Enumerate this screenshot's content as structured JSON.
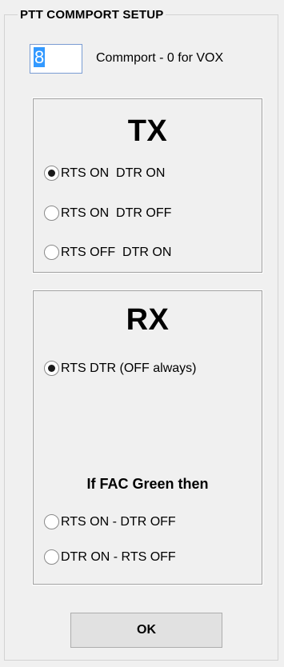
{
  "group": {
    "title": "PTT COMMPORT SETUP"
  },
  "commport": {
    "value": "8",
    "label": "Commport - 0 for VOX"
  },
  "tx": {
    "heading": "TX",
    "options": [
      {
        "label": "RTS ON  DTR ON",
        "checked": true
      },
      {
        "label": "RTS ON  DTR OFF",
        "checked": false
      },
      {
        "label": "RTS OFF  DTR ON",
        "checked": false
      }
    ]
  },
  "rx": {
    "heading": "RX",
    "always_option": {
      "label": "RTS DTR (OFF always)",
      "checked": true
    },
    "fac_heading": "If FAC Green then",
    "fac_options": [
      {
        "label": "RTS ON - DTR OFF",
        "checked": false
      },
      {
        "label": "DTR ON - RTS OFF",
        "checked": false
      }
    ]
  },
  "buttons": {
    "ok_label": "OK"
  }
}
